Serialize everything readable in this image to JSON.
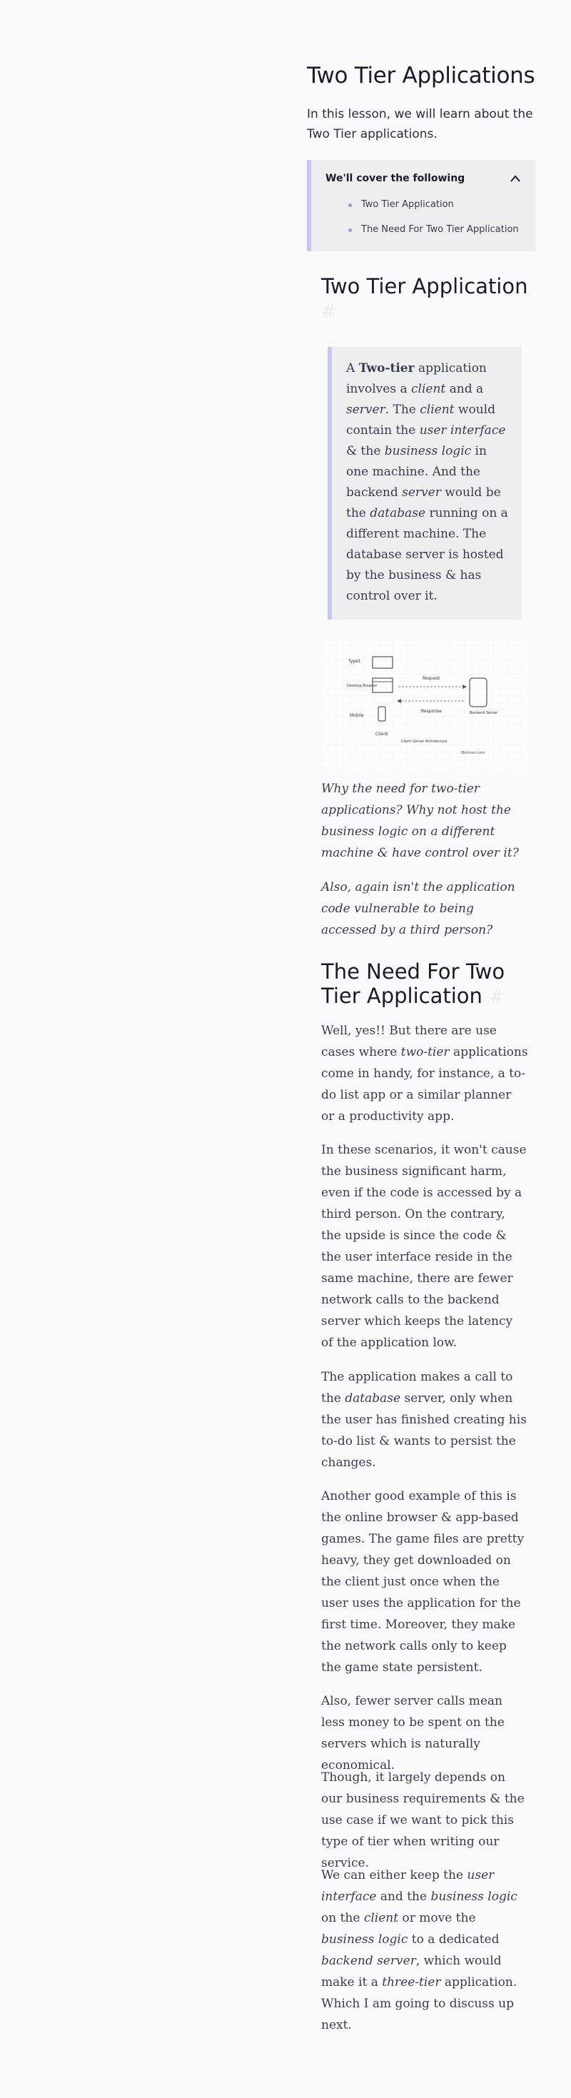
{
  "page": {
    "title": "Two Tier Applications",
    "intro": "In this lesson, we will learn about the Two Tier applications."
  },
  "toc": {
    "heading": "We'll cover the following",
    "items": [
      "Two Tier Application",
      "The Need For Two Tier Application"
    ]
  },
  "section1": {
    "heading": "Two Tier Application",
    "anchor": "#",
    "quote_html": "A <b>Two-tier</b> application involves a <i>client</i> and a <i>server</i>. The <i>client</i> would contain the <i>user interface</i> &amp; the <i>business logic</i> in one machine. And the backend <i>server</i> would be the <i>database</i> running on a different machine. The database server is hosted by the business &amp; has control over it."
  },
  "diagram": {
    "labels": {
      "type1": "Type1",
      "desktop": "Desktop Browser",
      "mobile": "Mobile",
      "request": "Request",
      "response": "Response",
      "backend": "Backend Server",
      "client": "Client",
      "caption": "Client Server Architecture",
      "watermark": "8bitmen.com"
    }
  },
  "questions": [
    "Why the need for two-tier applications? Why not host the business logic on a different machine & have control over it?",
    "Also, again isn't the application code vulnerable to being accessed by a third person?"
  ],
  "section2": {
    "heading_line1": "The Need For Two",
    "heading_line2": "Tier Application",
    "anchor": "#",
    "paragraphs_html": [
      "Well, yes!! But there are use cases where <i>two-tier</i> applications come in handy, for instance, a to-do list app or a similar planner or a productivity app.",
      "In these scenarios, it won't cause the business significant harm, even if the code is accessed by a third person. On the contrary, the upside is since the code &amp; the user interface reside in the same machine, there are fewer network calls to the backend server which keeps the latency of the application low.",
      "The application makes a call to the <i>database</i> server, only when the user has finished creating his to-do list &amp; wants to persist the changes.",
      "Another good example of this is the online browser &amp; app-based games. The game files are pretty heavy, they get downloaded on the client just once when the user uses the application for the first time. Moreover, they make the network calls only to keep the game state persistent.",
      "Also, fewer server calls mean less money to be spent on the servers which is naturally economical.",
      "Though, it largely depends on our business requirements &amp; the use case if we want to pick this type of tier when writing our service.",
      "We can either keep the <i>user interface</i> and the <i>business logic</i> on the <i>client</i> or move the <i>business logic</i> to a dedicated <i>backend server</i>, which would make it a <i>three-tier</i> application. Which I am going to discuss up next."
    ]
  },
  "colors": {
    "accent": "#c9c6f4",
    "panel": "#eeeeef",
    "heading": "#1c1c28",
    "text": "#3b3b4f"
  }
}
